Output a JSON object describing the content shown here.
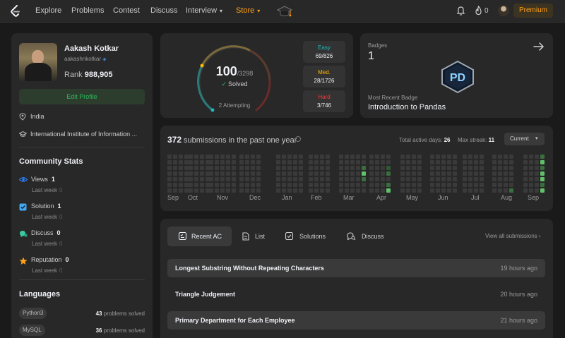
{
  "nav": {
    "items": [
      {
        "label": "Explore"
      },
      {
        "label": "Problems"
      },
      {
        "label": "Contest"
      },
      {
        "label": "Discuss"
      },
      {
        "label": "Interview"
      },
      {
        "label": "Store"
      }
    ],
    "streak_count": "0",
    "premium_label": "Premium",
    "accent_color": "#ffa116"
  },
  "profile": {
    "name": "Aakash Kotkar",
    "username": "aakashnkotkar",
    "rank_label": "Rank",
    "rank_value": "988,905",
    "edit_label": "Edit Profile",
    "location": "India",
    "school": "International Institute of Information ..."
  },
  "community": {
    "title": "Community Stats",
    "stats": [
      {
        "label": "Views",
        "value": "1",
        "sub": "Last week",
        "delta": "0",
        "icon": "eye-icon",
        "color": "#2d7ff9"
      },
      {
        "label": "Solution",
        "value": "1",
        "sub": "Last week",
        "delta": "0",
        "icon": "solution-check-icon",
        "color": "#3fa9f5"
      },
      {
        "label": "Discuss",
        "value": "0",
        "sub": "Last week",
        "delta": "0",
        "icon": "discuss-bubble-icon",
        "color": "#3cc8a0"
      },
      {
        "label": "Reputation",
        "value": "0",
        "sub": "Last week",
        "delta": "0",
        "icon": "star-icon",
        "color": "#ffa116"
      }
    ]
  },
  "languages": {
    "title": "Languages",
    "items": [
      {
        "name": "Python3",
        "count": "43",
        "suffix": "problems solved"
      },
      {
        "name": "MySQL",
        "count": "36",
        "suffix": "problems solved"
      }
    ]
  },
  "solved": {
    "count": "100",
    "total": "/3298",
    "label": "Solved",
    "attempting": "2 Attempting",
    "difficulties": [
      {
        "label": "Easy",
        "value": "69/826",
        "color": "#1cbaba"
      },
      {
        "label": "Med.",
        "value": "28/1726",
        "color": "#ffb700"
      },
      {
        "label": "Hard",
        "value": "3/746",
        "color": "#f63737"
      }
    ]
  },
  "badges": {
    "label": "Badges",
    "count": "1",
    "recent_label": "Most Recent Badge",
    "recent_name": "Introduction to Pandas",
    "badge_text": "PD"
  },
  "heatmap": {
    "count": "372",
    "title": "submissions in the past one year",
    "active_label": "Total active days:",
    "active_value": "26",
    "streak_label": "Max streak:",
    "streak_value": "11",
    "period": "Current",
    "months": [
      "Sep",
      "Oct",
      "Nov",
      "Dec",
      "Jan",
      "Feb",
      "Mar",
      "Apr",
      "May",
      "Jun",
      "Jul",
      "Aug",
      "Sep"
    ]
  },
  "tabs": {
    "items": [
      {
        "label": "Recent AC"
      },
      {
        "label": "List"
      },
      {
        "label": "Solutions"
      },
      {
        "label": "Discuss"
      }
    ],
    "view_all": "View all submissions"
  },
  "submissions": [
    {
      "title": "Longest Substring Without Repeating Characters",
      "time": "19 hours ago"
    },
    {
      "title": "Triangle Judgement",
      "time": "20 hours ago"
    },
    {
      "title": "Primary Department for Each Employee",
      "time": "21 hours ago"
    }
  ]
}
